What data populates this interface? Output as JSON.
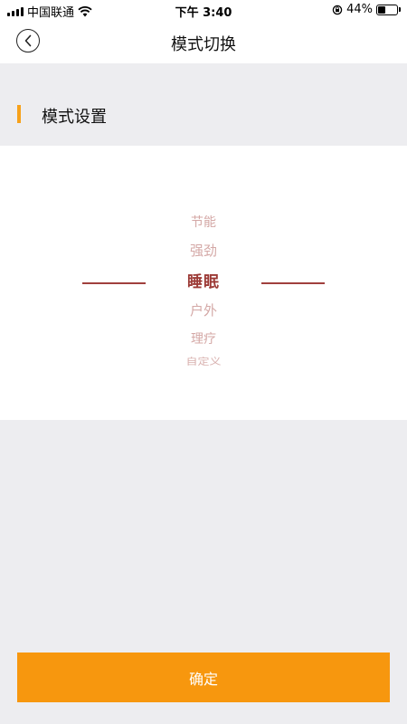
{
  "status_bar": {
    "carrier": "中国联通",
    "time": "下午 3:40",
    "battery_percent": "44%",
    "battery_level": 0.44
  },
  "nav": {
    "title": "模式切换",
    "back_icon": "chevron-left-icon"
  },
  "section": {
    "title": "模式设置",
    "accent_color": "#f7a11a"
  },
  "picker": {
    "options": [
      "节能",
      "强劲",
      "睡眠",
      "户外",
      "理疗",
      "自定义"
    ],
    "selected_index": 2,
    "selected_color": "#9c3a36"
  },
  "footer": {
    "confirm_label": "确定",
    "button_color": "#f7970e"
  }
}
